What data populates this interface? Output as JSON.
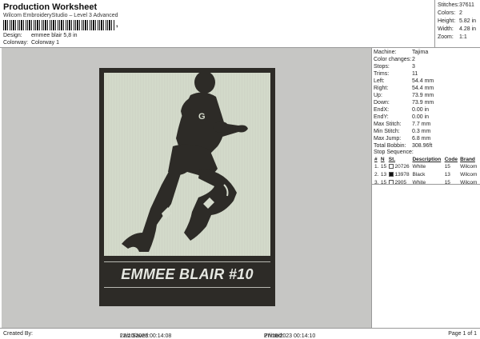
{
  "header": {
    "title": "Production Worksheet",
    "subtitle": "Wilcom EmbroideryStudio – Level 3 Advanced",
    "barcode_tail": ",",
    "design_label": "Design:",
    "design_value": "emmee blair 5,8 in",
    "colorway_label": "Colorway:",
    "colorway_value": "Colorway 1"
  },
  "stats": [
    {
      "label": "Stitches:",
      "value": "37611"
    },
    {
      "label": "Colors:",
      "value": "2"
    },
    {
      "label": "Height:",
      "value": "5.82 in"
    },
    {
      "label": "Width:",
      "value": "4.28 in"
    },
    {
      "label": "Zoom:",
      "value": "1:1"
    }
  ],
  "design": {
    "patch_text": "EMMEE BLAIR #10",
    "jersey_letter": "G",
    "colors": {
      "dark": "#2d2b27",
      "light": "#d6dccd",
      "canvas": "#c6c6c4",
      "text": "#e6e8e2"
    }
  },
  "properties": [
    {
      "label": "Machine:",
      "value": "Tajima"
    },
    {
      "label": "Color changes:",
      "value": "2"
    },
    {
      "label": "Stops:",
      "value": "3"
    },
    {
      "label": "Trims:",
      "value": "11"
    },
    {
      "label": "Left:",
      "value": "54.4 mm"
    },
    {
      "label": "Right:",
      "value": "54.4 mm"
    },
    {
      "label": "Up:",
      "value": "73.9 mm"
    },
    {
      "label": "Down:",
      "value": "73.9 mm"
    },
    {
      "label": "EndX:",
      "value": "0.00 in"
    },
    {
      "label": "EndY:",
      "value": "0.00 in"
    },
    {
      "label": "Max Stitch:",
      "value": "7.7 mm"
    },
    {
      "label": "Min Stitch:",
      "value": "0.3 mm"
    },
    {
      "label": "Max Jump:",
      "value": "6.8 mm"
    },
    {
      "label": "Total Bobbin:",
      "value": "308.96ft"
    }
  ],
  "stop_sequence": {
    "title": "Stop Sequence:",
    "headers": [
      "#",
      "N",
      "St.",
      "Description",
      "Code",
      "Brand"
    ],
    "rows": [
      {
        "num": "1.",
        "n": "15",
        "swatch": "#ffffff",
        "st": "20726",
        "desc": "White",
        "code": "15",
        "brand": "Wilcom"
      },
      {
        "num": "2.",
        "n": "13",
        "swatch": "#111111",
        "st": "13978",
        "desc": "Black",
        "code": "13",
        "brand": "Wilcom"
      },
      {
        "num": "3.",
        "n": "15",
        "swatch": "#ffffff",
        "st": "2905",
        "desc": "White",
        "code": "15",
        "brand": "Wilcom"
      }
    ]
  },
  "footer": {
    "created_by": "Created By:",
    "last_saved_label": "Last Saved:",
    "last_saved_value": "27/10/2023 00:14:08",
    "printed_label": "Printed:",
    "printed_value": "27/10/2023 00:14:10",
    "page": "Page 1 of 1"
  }
}
